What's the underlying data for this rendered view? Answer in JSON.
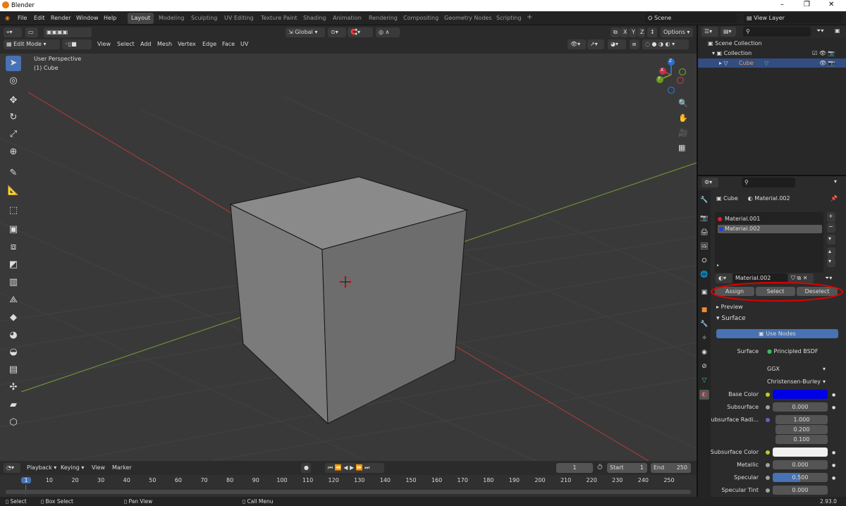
{
  "window": {
    "title": "Blender"
  },
  "menu": [
    "File",
    "Edit",
    "Render",
    "Window",
    "Help"
  ],
  "workspaces": [
    "Layout",
    "Modeling",
    "Sculpting",
    "UV Editing",
    "Texture Paint",
    "Shading",
    "Animation",
    "Rendering",
    "Compositing",
    "Geometry Nodes",
    "Scripting"
  ],
  "workspace_add": "+",
  "scene": {
    "label": "Scene"
  },
  "view_layer": {
    "label": "View Layer"
  },
  "viewport_header": {
    "transform_orientation": "Global",
    "xyz": [
      "X",
      "Y",
      "Z"
    ],
    "options": "Options",
    "mode": "Edit Mode",
    "menus": [
      "View",
      "Select",
      "Add",
      "Mesh",
      "Vertex",
      "Edge",
      "Face",
      "UV"
    ]
  },
  "viewport": {
    "perspective": "User Perspective",
    "object": "(1) Cube"
  },
  "gizmo": {
    "x": "X",
    "y": "Y",
    "z": "Z"
  },
  "outliner": {
    "root": "Scene Collection",
    "collection": "Collection",
    "object": "Cube"
  },
  "properties": {
    "breadcrumb_object": "Cube",
    "breadcrumb_material": "Material.002",
    "slots": [
      {
        "name": "Material.001",
        "color": "#e02020"
      },
      {
        "name": "Material.002",
        "color": "#2040e0"
      }
    ],
    "active_material": "Material.002",
    "buttons": [
      "Assign",
      "Select",
      "Deselect"
    ],
    "preview": "Preview",
    "surface": "Surface",
    "use_nodes": "Use Nodes",
    "surface_label": "Surface",
    "surface_shader": "Principled BSDF",
    "distribution": "GGX",
    "subsurface_method": "Christensen-Burley",
    "base_color_label": "Base Color",
    "base_color": "#0000e6",
    "subsurface_label": "Subsurface",
    "subsurface_value": "0.000",
    "subsurface_radius_label": "Subsurface Radi...",
    "radius": [
      "1.000",
      "0.200",
      "0.100"
    ],
    "subsurface_color_label": "Subsurface Color",
    "subsurface_color": "#f0f0f0",
    "metallic_label": "Metallic",
    "metallic": "0.000",
    "specular_label": "Specular",
    "specular": "0.500",
    "specular_tint_label": "Specular Tint",
    "specular_tint": "0.000"
  },
  "timeline": {
    "menus": [
      "Playback",
      "Keying",
      "View",
      "Marker"
    ],
    "current_frame": "1",
    "start_label": "Start",
    "start": "1",
    "end_label": "End",
    "end": "250",
    "ticks": [
      "1",
      "10",
      "20",
      "30",
      "40",
      "50",
      "60",
      "70",
      "80",
      "90",
      "100",
      "110",
      "120",
      "130",
      "140",
      "150",
      "160",
      "170",
      "180",
      "190",
      "200",
      "210",
      "220",
      "230",
      "240",
      "250"
    ]
  },
  "statusbar": {
    "select": "Select",
    "box_select": "Box Select",
    "pan_view": "Pan View",
    "call_menu": "Call Menu",
    "version": "2.93.0"
  },
  "annotation_color": "#e00000"
}
